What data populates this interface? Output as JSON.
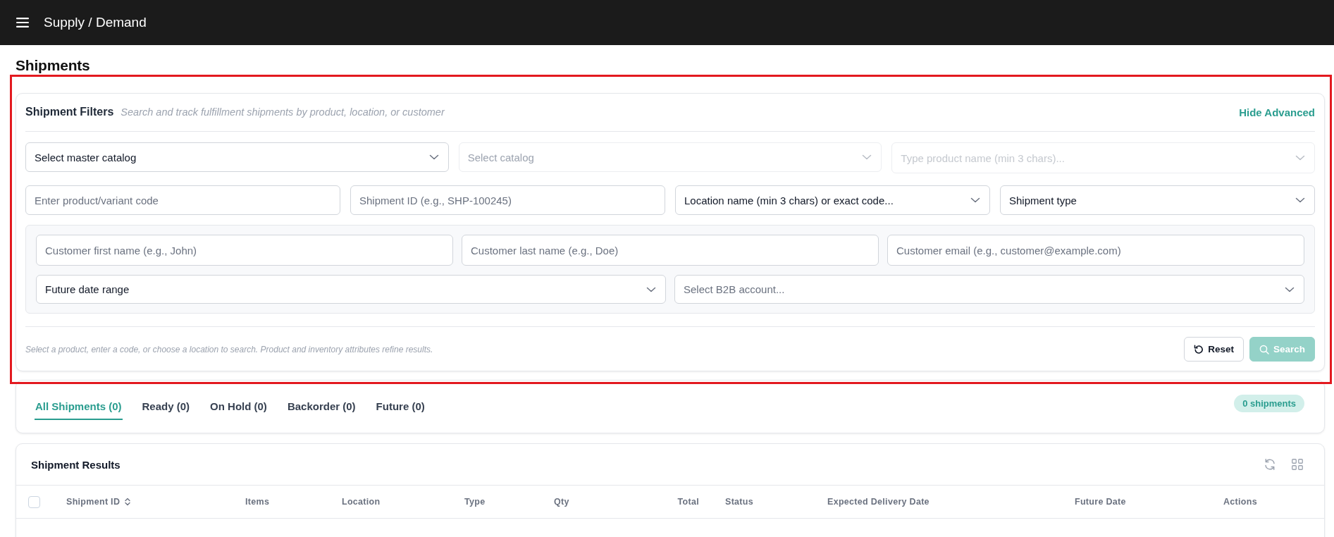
{
  "app_bar": {
    "title": "Supply / Demand"
  },
  "page": {
    "title": "Shipments"
  },
  "filters": {
    "highlighted": true,
    "title": "Shipment Filters",
    "subtitle": "Search and track fulfillment shipments by product, location, or customer",
    "toggle_label": "Hide Advanced",
    "catalog_row": [
      {
        "kind": "select",
        "value": "Select master catalog",
        "disabled": false
      },
      {
        "kind": "select",
        "value": "Select catalog",
        "disabled": true
      },
      {
        "kind": "combobox",
        "placeholder": "Type product name (min 3 chars)...",
        "disabled": true
      }
    ],
    "criteria_row": [
      {
        "kind": "input",
        "placeholder": "Enter product/variant code",
        "disabled": false
      },
      {
        "kind": "input",
        "placeholder": "Shipment ID (e.g., SHP-100245)",
        "disabled": false
      },
      {
        "kind": "select",
        "value": "Location name (min 3 chars) or exact code...",
        "disabled": false
      },
      {
        "kind": "select",
        "value": "Shipment type",
        "disabled": false
      }
    ],
    "advanced": {
      "expanded": true,
      "rows": [
        [
          {
            "kind": "input",
            "placeholder": "Customer first name (e.g., John)",
            "disabled": false
          },
          {
            "kind": "input",
            "placeholder": "Customer last name (e.g., Doe)",
            "disabled": false
          },
          {
            "kind": "input",
            "placeholder": "Customer email (e.g., customer@example.com)",
            "disabled": false
          }
        ],
        [
          {
            "kind": "select",
            "value": "Future date range",
            "disabled": false
          },
          {
            "kind": "select",
            "placeholder": "Select B2B account...",
            "disabled": false
          }
        ]
      ]
    },
    "hint": "Select a product, enter a code, or choose a location to search. Product and inventory attributes refine results.",
    "buttons": [
      {
        "kind": "reset",
        "label": "Reset",
        "disabled": false
      },
      {
        "kind": "search",
        "label": "Search",
        "disabled": true
      }
    ]
  },
  "tabs": [
    {
      "label": "All Shipments (0)",
      "selected": true
    },
    {
      "label": "Ready (0)",
      "selected": false
    },
    {
      "label": "On Hold (0)",
      "selected": false
    },
    {
      "label": "Backorder (0)",
      "selected": false
    },
    {
      "label": "Future (0)",
      "selected": false
    }
  ],
  "count_badge": "0 shipments",
  "results": {
    "title": "Shipment Results",
    "select_all": {
      "checked": false
    },
    "columns": [
      {
        "label": "Shipment ID",
        "sortable": true
      },
      {
        "label": "Items",
        "sortable": false
      },
      {
        "label": "Location",
        "sortable": false
      },
      {
        "label": "Type",
        "sortable": false
      },
      {
        "label": "Qty",
        "sortable": false
      },
      {
        "label": "Total",
        "sortable": false
      },
      {
        "label": "Status",
        "sortable": false
      },
      {
        "label": "Expected Delivery Date",
        "sortable": false
      },
      {
        "label": "Future Date",
        "sortable": false
      },
      {
        "label": "Actions",
        "sortable": false
      }
    ]
  }
}
